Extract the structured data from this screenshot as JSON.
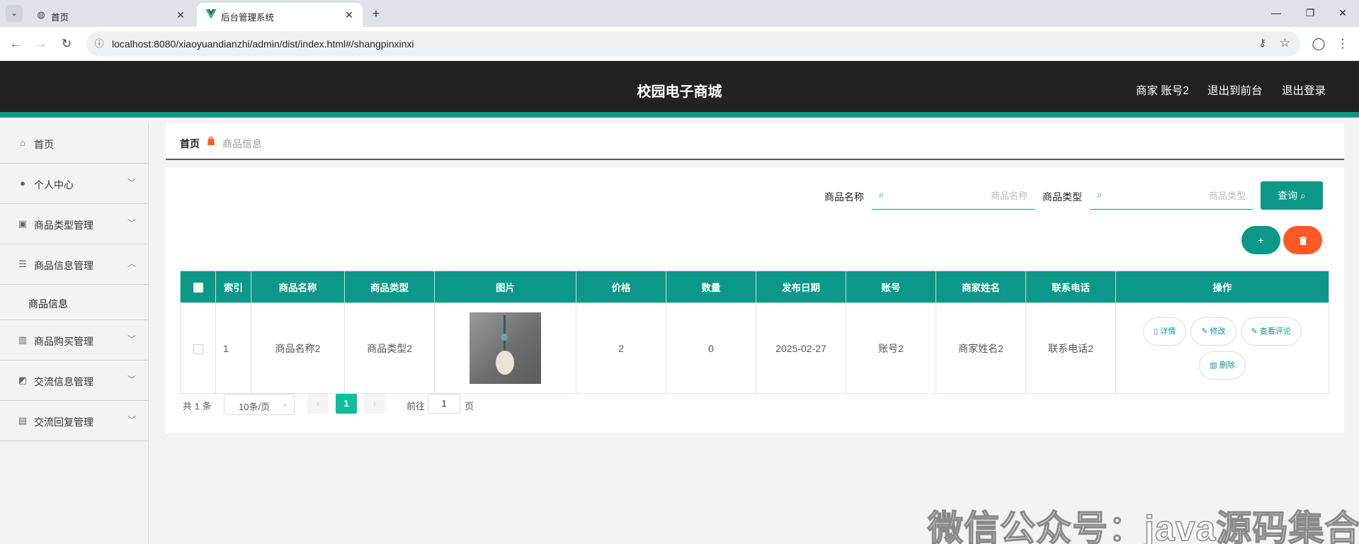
{
  "browser": {
    "tabs": [
      {
        "title": "首页",
        "icon": "globe-icon"
      },
      {
        "title": "后台管理系统",
        "icon": "vue-logo-icon"
      }
    ],
    "url": "localhost:8080/xiaoyuandianzhi/admin/dist/index.html#/shangpinxinxi"
  },
  "header": {
    "title": "校园电子商城",
    "user": "商家 账号2",
    "back_to_front": "退出到前台",
    "logout": "退出登录"
  },
  "sidebar": {
    "items": [
      {
        "label": "首页",
        "icon": "home-icon",
        "expandable": false
      },
      {
        "label": "个人中心",
        "icon": "user-icon",
        "expandable": true
      },
      {
        "label": "商品类型管理",
        "icon": "clipboard-icon",
        "expandable": true
      },
      {
        "label": "商品信息管理",
        "icon": "list-icon",
        "expandable": true,
        "expanded": true
      },
      {
        "label": "商品信息",
        "submenu": true
      },
      {
        "label": "商品购买管理",
        "icon": "bar-chart-icon",
        "expandable": true
      },
      {
        "label": "交流信息管理",
        "icon": "trend-chart-icon",
        "expandable": true
      },
      {
        "label": "交流回复管理",
        "icon": "message-icon",
        "expandable": true
      }
    ]
  },
  "breadcrumb": {
    "home": "首页",
    "current": "商品信息"
  },
  "search": {
    "name_label": "商品名称",
    "name_placeholder": "商品名称",
    "type_label": "商品类型",
    "type_placeholder": "商品类型",
    "query_button": "查询"
  },
  "actions": {
    "add_label": "+",
    "delete_icon": "trash-icon"
  },
  "table": {
    "columns": [
      "索引",
      "商品名称",
      "商品类型",
      "图片",
      "价格",
      "数量",
      "发布日期",
      "账号",
      "商家姓名",
      "联系电话",
      "操作"
    ],
    "rows": [
      {
        "index": "1",
        "name": "商品名称2",
        "type": "商品类型2",
        "image": "jade-pendant-photo",
        "price": "2",
        "quantity": "0",
        "date": "2025-02-27",
        "account": "账号2",
        "merchant": "商家姓名2",
        "phone": "联系电话2"
      }
    ],
    "row_actions": {
      "detail": "详情",
      "edit": "修改",
      "reviews": "查看评论",
      "delete": "删除"
    }
  },
  "pagination": {
    "total": "共 1 条",
    "page_size": "10条/页",
    "current_page": "1",
    "goto_prefix": "前往",
    "goto_value": "1",
    "goto_suffix": "页"
  },
  "watermark": "微信公众号：java源码集合",
  "colors": {
    "accent": "#0b9888",
    "header_bg": "#222222",
    "danger": "#ff5a26"
  }
}
